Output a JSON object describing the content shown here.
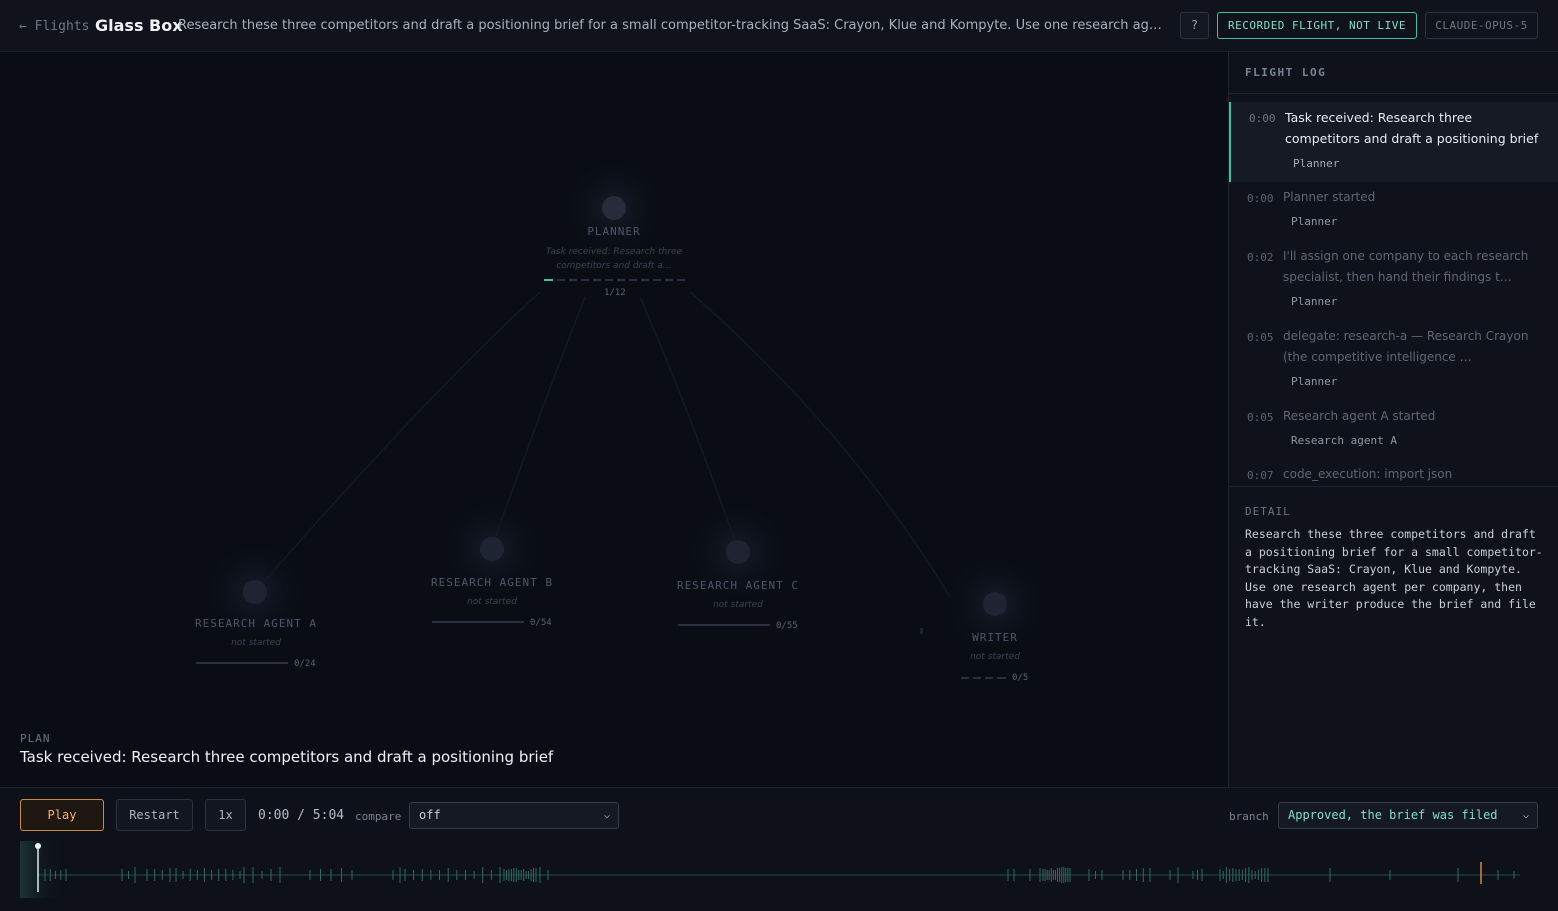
{
  "header": {
    "back_label": "← Flights",
    "app_title": "Glass Box",
    "task": "Research these three competitors and draft a positioning brief for a small competitor-tracking SaaS: Crayon, Klue and Kompyte. Use one research agent per company, then have the writer produce the brief and file it.",
    "help_label": "?",
    "recorded_badge": "RECORDED FLIGHT, NOT LIVE",
    "model_badge": "CLAUDE-OPUS-5"
  },
  "graph": {
    "nodes": [
      {
        "id": "planner",
        "label": "PLANNER",
        "status": "Task received: Research three competitors and draft a…",
        "count": "1/12",
        "progress": 0.083
      },
      {
        "id": "research-a",
        "label": "RESEARCH AGENT A",
        "status": "not started",
        "count": "0/24",
        "progress": 0
      },
      {
        "id": "research-b",
        "label": "RESEARCH AGENT B",
        "status": "not started",
        "count": "0/54",
        "progress": 0
      },
      {
        "id": "research-c",
        "label": "RESEARCH AGENT C",
        "status": "not started",
        "count": "0/55",
        "progress": 0
      },
      {
        "id": "writer",
        "label": "WRITER",
        "status": "not started",
        "count": "0/5",
        "progress": 0
      }
    ]
  },
  "plan": {
    "label": "PLAN",
    "text": "Task received: Research three competitors and draft a positioning brief"
  },
  "flight_log": {
    "title": "FLIGHT LOG",
    "entries": [
      {
        "time": "0:00",
        "text": "Task received: Research three competitors and draft a positioning brief",
        "agent": "Planner"
      },
      {
        "time": "0:00",
        "text": "Planner started",
        "agent": "Planner"
      },
      {
        "time": "0:02",
        "text": "I'll assign one company to each research specialist, then hand their findings t…",
        "agent": "Planner"
      },
      {
        "time": "0:05",
        "text": "delegate: research-a — Research Crayon (the competitive intelligence …",
        "agent": "Planner"
      },
      {
        "time": "0:05",
        "text": "Research agent A started",
        "agent": "Research agent A"
      },
      {
        "time": "0:07",
        "text": "code_execution: import json",
        "agent": ""
      }
    ]
  },
  "detail": {
    "title": "DETAIL",
    "body": "Research these three competitors and draft a positioning brief for a small competitor-tracking SaaS: Crayon, Klue and Kompyte. Use one research agent per company, then have the writer produce the brief and file it."
  },
  "controls": {
    "play_label": "Play",
    "restart_label": "Restart",
    "speed_label": "1x",
    "time_readout": "0:00 / 5:04",
    "compare_label": "compare",
    "compare_value": "off",
    "branch_label": "branch",
    "branch_value": "Approved, the brief was filed"
  },
  "timeline": {
    "duration_seconds": 304,
    "current_seconds": 0,
    "marker_seconds": 289,
    "accent": "#3fbfa4",
    "marker_color": "#c98a4a"
  },
  "colors": {
    "accent": "#3fbfa4",
    "play": "#f0b27a",
    "branch_text": "#7fe0c8"
  }
}
